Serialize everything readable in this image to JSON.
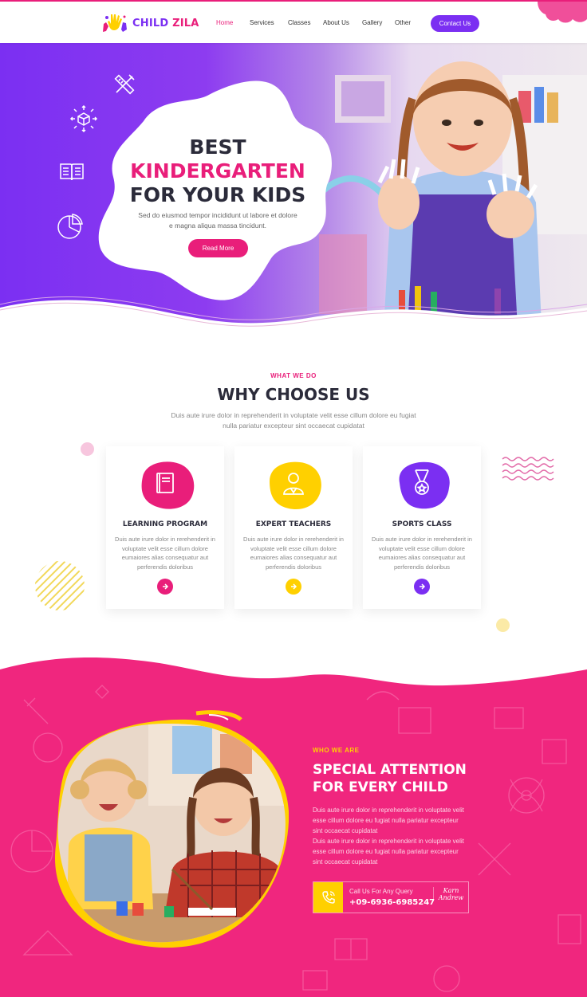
{
  "brand": {
    "name_part1": "CHILD",
    "name_part2": "ZILA",
    "colors": {
      "pink": "#e91e7a",
      "purple": "#7b2ff2",
      "yellow": "#ffd000",
      "dark": "#2b2b3a"
    }
  },
  "nav": {
    "items": [
      {
        "label": "Home",
        "active": true
      },
      {
        "label": "Services",
        "active": false
      },
      {
        "label": "Classes",
        "active": false
      },
      {
        "label": "About Us",
        "active": false
      },
      {
        "label": "Gallery",
        "active": false
      },
      {
        "label": "Other",
        "active": false
      }
    ],
    "contact_label": "Contact Us"
  },
  "hero": {
    "title_line1": "BEST",
    "title_line2": "KINDERGARTEN",
    "title_line3": "FOR YOUR KIDS",
    "description": "Sed do eiusmod tempor incididunt ut labore et dolore e magna aliqua massa tincidunt.",
    "button_label": "Read More",
    "side_icons": [
      "ruler-pencil-icon",
      "cube-icon",
      "book-icon",
      "chart-icon"
    ]
  },
  "why": {
    "eyebrow": "WHAT WE DO",
    "title": "WHY CHOOSE US",
    "description_line1": "Duis aute irure dolor in reprehenderit in voluptate velit esse cillum dolore eu fugiat",
    "description_line2": "nulla pariatur excepteur sint occaecat cupidatat",
    "cards": [
      {
        "title": "LEARNING PROGRAM",
        "text": "Duis aute irure dolor in rerehenderit in voluptate velit esse cillum dolore eumaiores alias consequatur aut perferendis doloribus",
        "icon": "book-icon",
        "color": "#e91e7a"
      },
      {
        "title": "EXPERT TEACHERS",
        "text": "Duis aute irure dolor in rerehenderit in voluptate velit esse cillum dolore eumaiores alias consequatur aut perferendis doloribus",
        "icon": "teacher-icon",
        "color": "#ffd000"
      },
      {
        "title": "SPORTS CLASS",
        "text": "Duis aute irure dolor in rerehenderit in voluptate velit esse cillum dolore eumaiores alias consequatur aut perferendis doloribus",
        "icon": "medal-icon",
        "color": "#7b2ff2"
      }
    ]
  },
  "who": {
    "eyebrow": "WHO WE ARE",
    "title_line1": "SPECIAL ATTENTION",
    "title_line2": "FOR EVERY CHILD",
    "paragraph1": "Duis aute irure dolor in reprehenderit in voluptate velit esse cillum dolore eu fugiat nulla pariatur excepteur sint occaecat cupidatat",
    "paragraph2": "Duis aute irure dolor in reprehenderit in voluptate velit esse cillum dolore eu fugiat nulla pariatur excepteur sint occaecat cupidatat",
    "call_label": "Call Us For Any Query",
    "call_number": "+09-6936-6985247",
    "signature_line1": "Karn",
    "signature_line2": "Andrew"
  }
}
